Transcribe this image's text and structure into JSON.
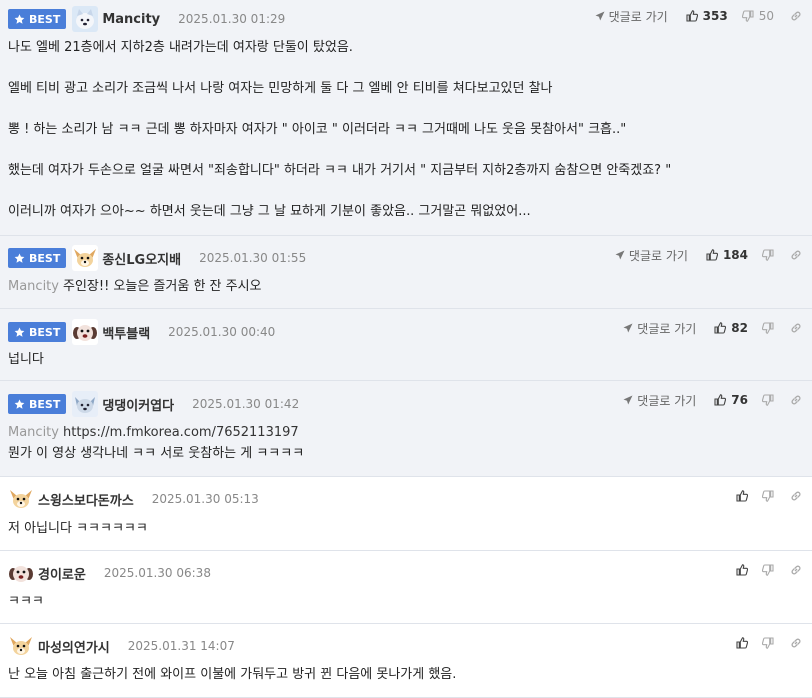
{
  "labels": {
    "best": "BEST",
    "reply": "댓글로 가기"
  },
  "comments": [
    {
      "author": "Mancity",
      "date": "2025.01.30 01:29",
      "up": "353",
      "down": "50",
      "paragraphs": [
        "나도 엘베 21층에서 지하2층 내려가는데 여자랑 단둘이 탔었음.",
        "엘베 티비 광고 소리가 조금씩 나서 나랑 여자는 민망하게 둘 다 그 엘베 안 티비를 쳐다보고있던 찰나",
        "뽕 ! 하는 소리가 남 ㅋㅋ 근데 뽕 하자마자 여자가 \" 아이코 \" 이러더라 ㅋㅋ 그거때메 나도 웃음 못참아서\" 크흡..\"",
        "했는데 여자가 두손으로 얼굴 싸면서 \"죄송합니다\" 하더라 ㅋㅋ 내가 거기서 \" 지금부터 지하2층까지 숨참으면 안죽겠죠? \"",
        "이러니까 여자가 으아~~ 하면서 웃는데 그냥 그 날 묘하게 기분이 좋았음.. 그거말곤 뭐없었어..."
      ]
    },
    {
      "author": "종신LG오지배",
      "date": "2025.01.30 01:55",
      "up": "184",
      "mention": "Mancity",
      "text": "주인장!! 오늘은 즐거움 한 잔 주시오"
    },
    {
      "author": "백투블랙",
      "date": "2025.01.30 00:40",
      "up": "82",
      "text": "넙니다"
    },
    {
      "author": "댕댕이커엽다",
      "date": "2025.01.30 01:42",
      "up": "76",
      "mention": "Mancity",
      "url": "https://m.fmkorea.com/7652113197",
      "text": "뭔가 이 영상 생각나네 ㅋㅋ 서로 웃참하는 게 ㅋㅋㅋㅋ"
    },
    {
      "author": "스윙스보다돈까스",
      "date": "2025.01.30 05:13",
      "text": "저 아닙니다 ㅋㅋㅋㅋㅋㅋ"
    },
    {
      "author": "경이로운",
      "date": "2025.01.30 06:38",
      "text": "ㅋㅋㅋ"
    },
    {
      "author": "마성의연가시",
      "date": "2025.01.31 14:07",
      "text": "난 오늘 아침 출근하기 전에 와이프 이불에 가둬두고 방귀 뀐 다음에 못나가게 했음."
    }
  ]
}
